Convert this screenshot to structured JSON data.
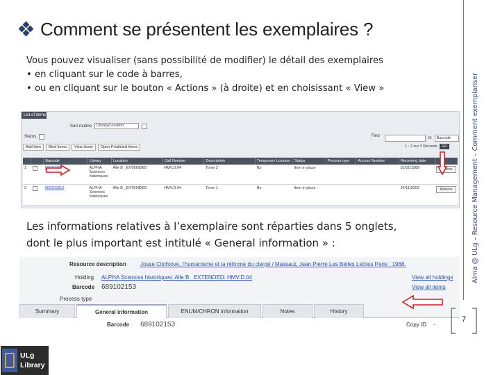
{
  "slide": {
    "title": "Comment se présentent les exemplaires ?",
    "intro_line": "Vous pouvez visualiser (sans possibilité de modifier) le détail des exemplaires",
    "bullet_1": "• en cliquant sur le code à barres,",
    "bullet_2": "• ou en cliquant sur le bouton « Actions » (à droite) et en choisissant « View »",
    "para_line_1": "Les informations relatives à l’exemplaire sont réparties dans 5 onglets,",
    "para_line_2": "dont le plus important est intitulé « General information » :",
    "side_text": "Alma @ ULg – Resource Management – Comment exemplariser",
    "page_number": "7",
    "logo_line_1": "ULg",
    "logo_line_2": "Library",
    "colors": {
      "accent": "#2e4a84",
      "arrow": "#cc1f1f",
      "table_header": "#4b5260"
    }
  },
  "items_list": {
    "tab_label": "List of items",
    "sort_label": "Sort routine",
    "sort_value": "Library/Location",
    "status_label": "Status",
    "find_label": "Find :",
    "in_label": "In",
    "in_value": "Barcode",
    "go_label": "GO",
    "pager": "1 - 2 sur 2 Records",
    "buttons": [
      "Add Item",
      "Bind Items",
      "View Items",
      "Open Predicted Items"
    ],
    "columns": [
      "Barcode",
      "Library",
      "Location",
      "Call Number",
      "Description",
      "Temporary Location",
      "Status",
      "Process type",
      "Access Number",
      "Receiving date"
    ],
    "rows": [
      {
        "num": "1",
        "barcode": "689102153",
        "library": "ALPHA Sciences historiques",
        "location": "Alle B _EXTENDED",
        "call_number": "HMV.D.04",
        "description": "Tome 2",
        "temp_location": "No",
        "status": "Item in place",
        "process_type": "",
        "access_number": "",
        "receiving_date": "01/01/1988",
        "action": "Actions"
      },
      {
        "num": "2",
        "barcode": "005203310",
        "library": "ALPHA Sciences historiques",
        "location": "Alle B _EXTENDED",
        "call_number": "HMV.D.04",
        "description": "Tome 1",
        "temp_location": "No",
        "status": "Item in place",
        "process_type": "",
        "access_number": "",
        "receiving_date": "24/11/2003",
        "action": "Actions"
      }
    ]
  },
  "item_detail": {
    "resource_label": "Resource description",
    "resource_value": "Josse Clichtove, l'humanisme et la réforme du clergé / Massaut, Jean Pierre Les Belles Lettres Paris : 1968.",
    "holding_label": "Holding",
    "holding_value": "ALPHA Sciences historiques: Alle B _EXTENDED: HMV.D.04",
    "barcode_label": "Barcode",
    "barcode_value": "689102153",
    "process_label": "Process type",
    "view_holdings": "View all holdings",
    "view_items": "View all items",
    "tabs": [
      "Summary",
      "General information",
      "ENUM/CHRON information",
      "Notes",
      "History"
    ],
    "field_label": "Barcode",
    "field_value": "689102153",
    "copy_label": "Copy ID",
    "copy_value": "-"
  }
}
